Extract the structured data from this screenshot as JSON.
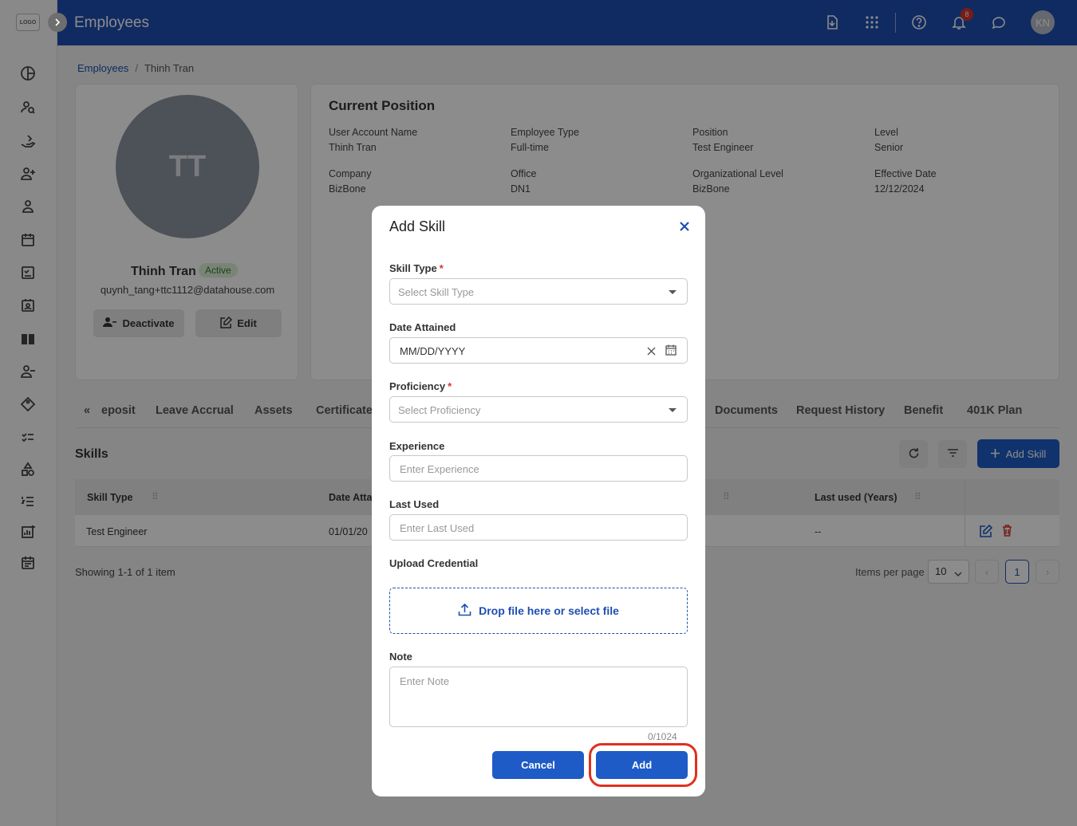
{
  "app": {
    "logo_text": "LOGO",
    "page_title": "Employees",
    "notification_count": "8",
    "user_initials": "KN"
  },
  "breadcrumb": {
    "root": "Employees",
    "current": "Thinh Tran"
  },
  "profile": {
    "initials": "TT",
    "name": "Thinh Tran",
    "status": "Active",
    "email": "quynh_tang+ttc1112@datahouse.com",
    "deactivate_label": "Deactivate",
    "edit_label": "Edit"
  },
  "position": {
    "title": "Current Position",
    "fields": [
      {
        "label": "User Account Name",
        "value": "Thinh Tran"
      },
      {
        "label": "Employee Type",
        "value": "Full-time"
      },
      {
        "label": "Position",
        "value": "Test Engineer"
      },
      {
        "label": "Level",
        "value": "Senior"
      },
      {
        "label": "Company",
        "value": "BizBone"
      },
      {
        "label": "Office",
        "value": "DN1"
      },
      {
        "label": "Organizational Level",
        "value": "BizBone"
      },
      {
        "label": "Effective Date",
        "value": "12/12/2024"
      }
    ]
  },
  "tabs": [
    "eposit",
    "Leave Accrual",
    "Assets",
    "Certificates",
    "Documents",
    "Request History",
    "Benefit",
    "401K Plan"
  ],
  "skills": {
    "title": "Skills",
    "add_label": "Add Skill",
    "columns": [
      "Skill Type",
      "Date Atta",
      "Last used (Years)"
    ],
    "rows": [
      {
        "skill_type": "Test Engineer",
        "date": "01/01/20",
        "last_used": "--"
      }
    ],
    "showing": "Showing 1-1 of 1 item",
    "items_per_page_label": "Items per page",
    "items_per_page": "10",
    "current_page": "1"
  },
  "modal": {
    "title": "Add Skill",
    "skill_type_label": "Skill Type",
    "skill_type_placeholder": "Select Skill Type",
    "date_label": "Date Attained",
    "date_placeholder": "MM/DD/YYYY",
    "proficiency_label": "Proficiency",
    "proficiency_placeholder": "Select Proficiency",
    "experience_label": "Experience",
    "experience_placeholder": "Enter Experience",
    "last_used_label": "Last Used",
    "last_used_placeholder": "Enter Last Used",
    "upload_label": "Upload Credential",
    "upload_text": "Drop file here or select file",
    "note_label": "Note",
    "note_placeholder": "Enter Note",
    "counter": "0/1024",
    "cancel_label": "Cancel",
    "add_label": "Add"
  },
  "colors": {
    "primary": "#1e4fb2",
    "button": "#1e5bc6",
    "highlight": "#e0301e"
  }
}
